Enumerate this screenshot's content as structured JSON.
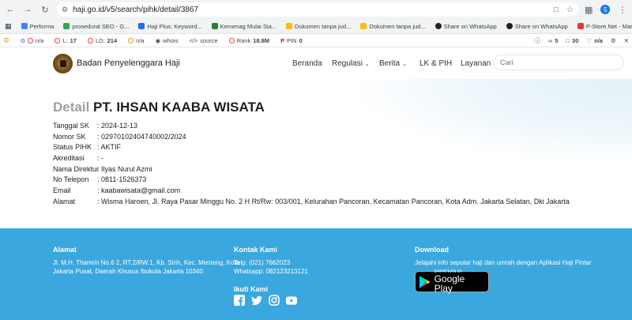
{
  "browser": {
    "url": "haji.go.id/v5/search/pihk/detail/3867",
    "extension_label": "5"
  },
  "bookmarks": [
    {
      "label": "Performa",
      "color": "#4285f4"
    },
    {
      "label": "prosedural SEO - G...",
      "color": "#34a853"
    },
    {
      "label": "Haji Plus: Keyword...",
      "color": "#1a73e8"
    },
    {
      "label": "Kemenag Mulai Sia...",
      "color": "#2e7d32"
    },
    {
      "label": "Dokumen tanpa jud...",
      "color": "#fbbc04"
    },
    {
      "label": "Dokumen tanpa jud...",
      "color": "#fbbc04"
    },
    {
      "label": "Share on WhatsApp",
      "color": "#222222"
    },
    {
      "label": "Share on WhatsApp",
      "color": "#222222"
    },
    {
      "label": "P-Store.Net - Marke...",
      "color": "#e53935"
    }
  ],
  "seobar": {
    "g": "n/a",
    "l": "17",
    "ld": "214",
    "b": "n/a",
    "whois": "whois",
    "source": "source",
    "rank_label": "Rank",
    "rank_value": "18.8M",
    "pin_label": "PIN",
    "pin_value": "0",
    "r1": "5",
    "r2": "30",
    "r3": "n/a"
  },
  "site": {
    "brand": "Badan Penyelenggara Haji",
    "menu": {
      "beranda": "Beranda",
      "regulasi": "Regulasi",
      "berita": "Berita",
      "lk_pih": "LK & PIH",
      "layanan": "Layanan"
    },
    "search_placeholder": "Cari"
  },
  "detail": {
    "title_prefix": "Detail",
    "title_name": "PT. IHSAN KAABA WISATA",
    "rows": [
      {
        "label": "Tanggal SK",
        "value": ": 2024-12-13"
      },
      {
        "label": "Nomor SK",
        "value": ": 02970102404740002/2024"
      },
      {
        "label": "Status PIHK",
        "value": ": AKTIF"
      },
      {
        "label": "Akreditasi",
        "value": ": -"
      },
      {
        "label": "Nama Direktur",
        "value": ": Ilyas Nurul Azmi"
      },
      {
        "label": "No Telepon",
        "value": ": 0811-1526373"
      },
      {
        "label": "Email",
        "value": ": kaabawisata@gmail.com"
      },
      {
        "label": "Alamat",
        "value": ": Wisma Haroen, Jl. Raya Pasar Minggu No. 2 H Rt/Rw: 003/001, Kelurahan Pancoran, Kecamatan Pancoran, Kota Adm. Jakarta Selatan, Dki Jakarta"
      }
    ]
  },
  "footer": {
    "alamat_title": "Alamat",
    "alamat_line1": "Jl. M.H. Thamrin No.6 2, RT.2/RW.1, Kb. Sirih, Kec. Menteng, Kota",
    "alamat_line2": "Jakarta Pusat, Daerah Khusus Ibukota Jakarta 10340",
    "kontak_title": "Kontak Kami",
    "telp": "Telp: (021) 7662023",
    "whatsapp": "Whatsapp: 082123213121",
    "ikuti_title": "Ikuti Kami",
    "download_title": "Download",
    "download_text": "Jelajahi info seputar haji dan umrah dengan Aplikasi Haji Pintar",
    "gplay_small": "DAPATKAN DI",
    "gplay_big": "Google Play"
  },
  "colors": {
    "footer_bg": "#3aa7df",
    "title_gray": "#9aa0a6"
  }
}
